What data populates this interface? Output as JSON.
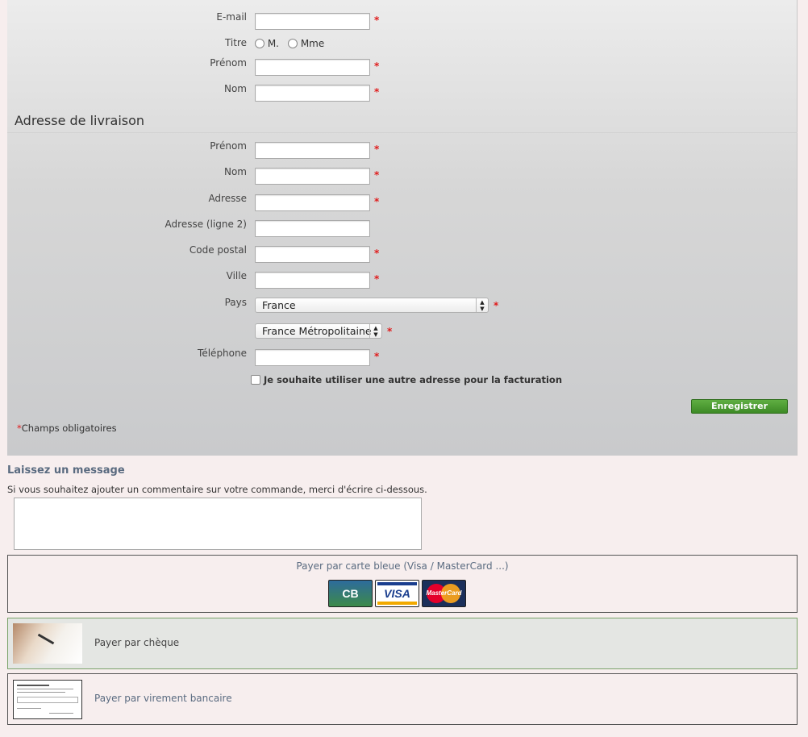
{
  "billing": {
    "email_label": "E-mail",
    "titre_label": "Titre",
    "titre_options": [
      "M.",
      "Mme"
    ],
    "prenom_label": "Prénom",
    "nom_label": "Nom"
  },
  "shipping": {
    "section_title": "Adresse de livraison",
    "prenom_label": "Prénom",
    "nom_label": "Nom",
    "adresse_label": "Adresse",
    "adresse2_label": "Adresse (ligne 2)",
    "code_postal_label": "Code postal",
    "ville_label": "Ville",
    "pays_label": "Pays",
    "pays_value": "France",
    "region_value": "France Métropolitaine",
    "telephone_label": "Téléphone",
    "billing_checkbox_label": "Je souhaite utiliser une autre adresse pour la facturation",
    "save_label": "Enregistrer",
    "required_star": "*",
    "required_note": "Champs obligatoires"
  },
  "message": {
    "title": "Laissez un message",
    "subtitle": "Si vous souhaitez ajouter un commentaire sur votre commande, merci d'écrire ci-dessous.",
    "value": ""
  },
  "payment": {
    "card_label": "Payer par carte bleue (Visa / MasterCard ...)",
    "card_logos": [
      "CB",
      "VISA",
      "MasterCard"
    ],
    "cheque_label": "Payer par chèque",
    "virement_label": "Payer par virement bancaire"
  },
  "colors": {
    "required": "#e01b1b",
    "save_button": "#4c9b33",
    "message_title": "#5a6b80",
    "cheque_border": "#7aa36a",
    "page_bg": "#f7eeee"
  }
}
